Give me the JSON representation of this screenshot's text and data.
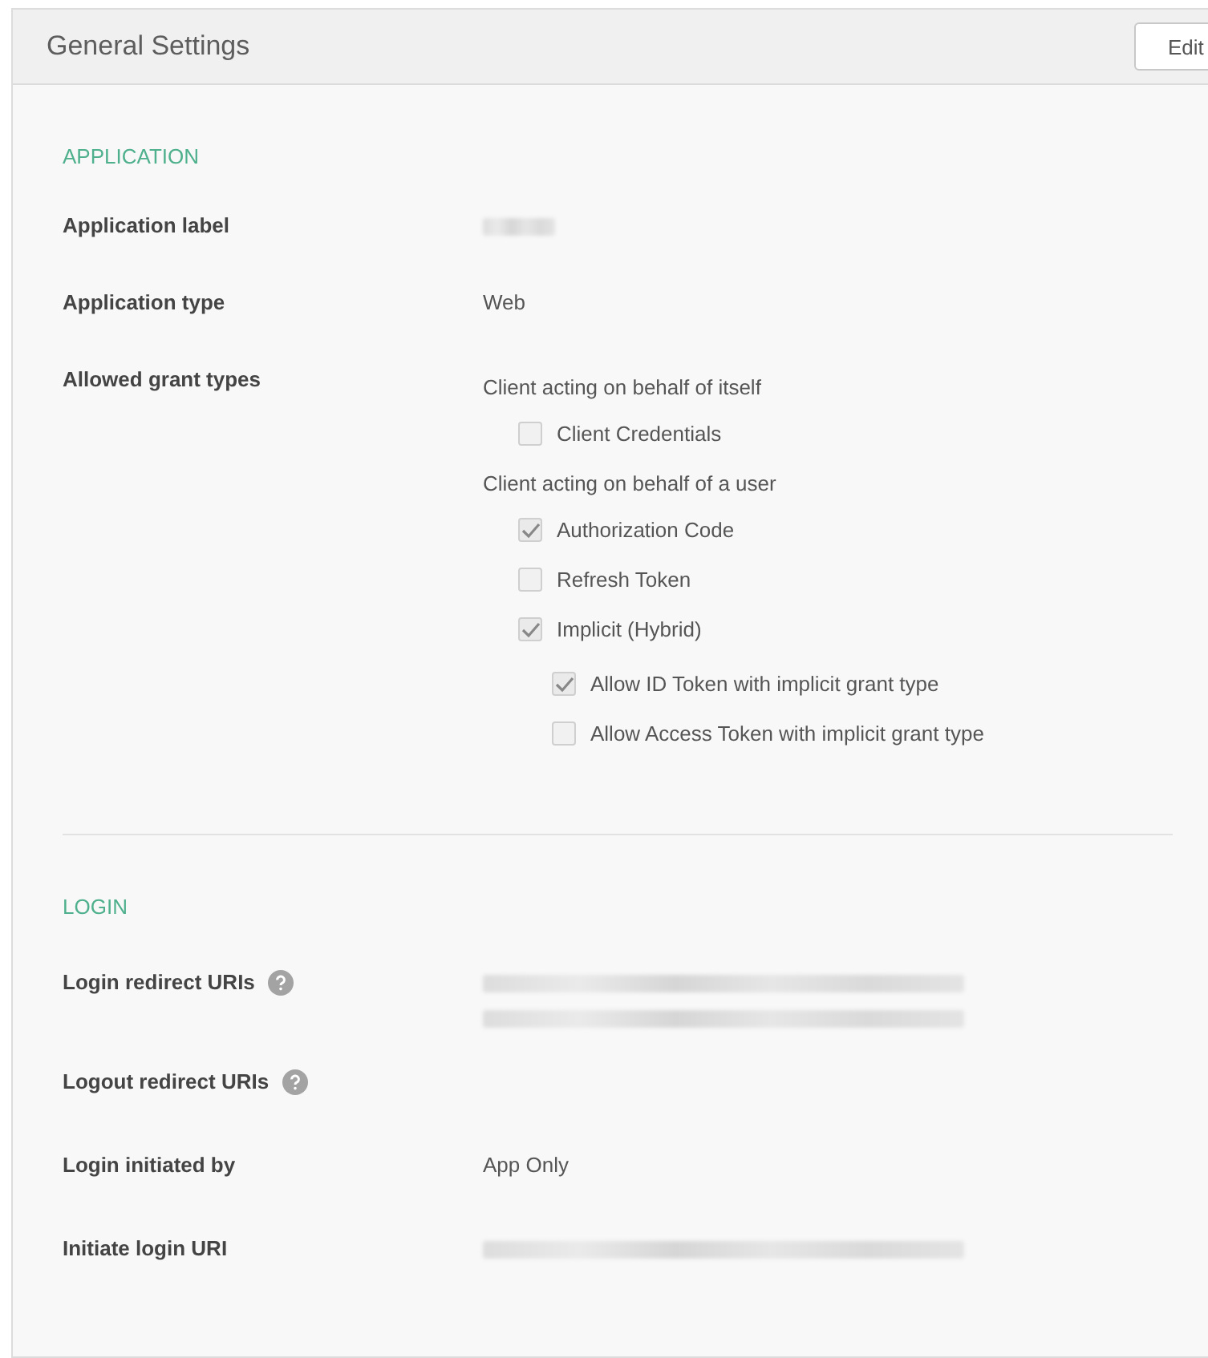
{
  "panel": {
    "title": "General Settings",
    "edit_button": "Edit"
  },
  "sections": [
    {
      "heading": "APPLICATION",
      "rows": [
        {
          "label": "Application label",
          "help": false,
          "values": [
            {
              "kind": "blurred_word"
            }
          ]
        },
        {
          "label": "Application type",
          "help": false,
          "values": [
            {
              "kind": "text",
              "text": "Web"
            }
          ]
        },
        {
          "label": "Allowed grant types",
          "help": false,
          "values": [
            {
              "kind": "grants",
              "groups": [
                {
                  "caption": "Client acting on behalf of itself",
                  "options": [
                    {
                      "label": "Client Credentials",
                      "checked": false
                    }
                  ]
                },
                {
                  "caption": "Client acting on behalf of a user",
                  "options": [
                    {
                      "label": "Authorization Code",
                      "checked": true
                    },
                    {
                      "label": "Refresh Token",
                      "checked": false
                    },
                    {
                      "label": "Implicit (Hybrid)",
                      "checked": true,
                      "children": [
                        {
                          "label": "Allow ID Token with implicit grant type",
                          "checked": true
                        },
                        {
                          "label": "Allow Access Token with implicit grant type",
                          "checked": false
                        }
                      ]
                    }
                  ]
                }
              ]
            }
          ]
        }
      ]
    },
    {
      "heading": "LOGIN",
      "rows": [
        {
          "label": "Login redirect URIs",
          "help": true,
          "values": [
            {
              "kind": "blurred_line"
            },
            {
              "kind": "blurred_line"
            }
          ]
        },
        {
          "label": "Logout redirect URIs",
          "help": true,
          "values": []
        },
        {
          "label": "Login initiated by",
          "help": false,
          "values": [
            {
              "kind": "text",
              "text": "App Only"
            }
          ]
        },
        {
          "label": "Initiate login URI",
          "help": false,
          "values": [
            {
              "kind": "blurred_line"
            }
          ]
        }
      ]
    }
  ]
}
